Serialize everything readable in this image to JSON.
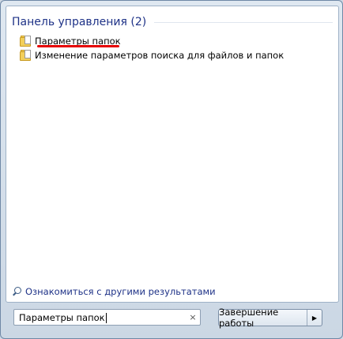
{
  "group": {
    "title": "Панель управления (2)",
    "items": [
      {
        "label": "Параметры папок",
        "icon": "folder-options-icon"
      },
      {
        "label": "Изменение параметров поиска для файлов и папок",
        "icon": "folder-options-icon"
      }
    ]
  },
  "see_more": {
    "label": "Ознакомиться с другими результатами",
    "icon": "search-icon"
  },
  "search": {
    "value": "Параметры папок",
    "clear_glyph": "×"
  },
  "shutdown": {
    "label": "Завершение работы",
    "arrow_glyph": "▶"
  }
}
